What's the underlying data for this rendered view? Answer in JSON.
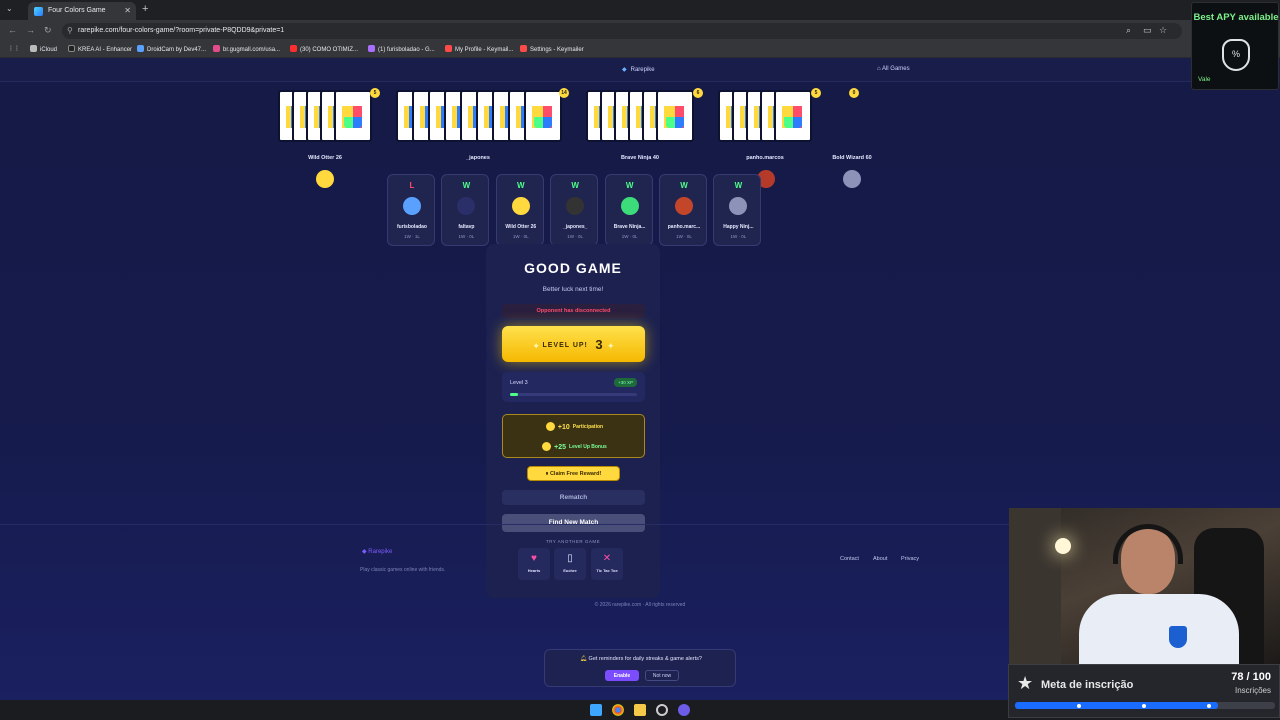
{
  "browser": {
    "tab_title": "Four Colors Game",
    "url": "rarepike.com/four-colors-game/?room=private-P8QDD9&private=1",
    "bookmarks": [
      "iCloud",
      "KREA AI - Enhancer",
      "DroidCam by Dev47...",
      "br.gugmall.com/usa...",
      "(30) COMO OTIMIZ...",
      "(1) furisboladao - G...",
      "My Profile - Keymail...",
      "Settings - Keymailer"
    ]
  },
  "site": {
    "brand": "Rarepike",
    "all_games": "All Games"
  },
  "players": [
    {
      "name": "Wild Otter 26",
      "cards": "5"
    },
    {
      "name": "_japones",
      "cards": "14"
    },
    {
      "name": "Brave Ninja 40",
      "cards": "6"
    },
    {
      "name": "panho.marcos",
      "cards": "5"
    },
    {
      "name": "Bold Wizard 60",
      "cards": "0"
    }
  ],
  "results": [
    {
      "res": "L",
      "name": "furisboladao",
      "wl": "1W · 1L",
      "color": "#ff4d6a"
    },
    {
      "res": "W",
      "name": "faltavp",
      "wl": "1W · 0L",
      "color": "#4cff88"
    },
    {
      "res": "W",
      "name": "Wild Otter 26",
      "wl": "1W · 0L",
      "color": "#4cff88"
    },
    {
      "res": "W",
      "name": "_japones_",
      "wl": "1W · 0L",
      "color": "#4cff88"
    },
    {
      "res": "W",
      "name": "Brave Ninja...",
      "wl": "1W · 0L",
      "color": "#4cff88"
    },
    {
      "res": "W",
      "name": "panho.marc...",
      "wl": "1W · 0L",
      "color": "#4cff88"
    },
    {
      "res": "W",
      "name": "Happy Ninj...",
      "wl": "1W · 0L",
      "color": "#4cff88"
    }
  ],
  "modal": {
    "title": "GOOD GAME",
    "subtitle": "Better luck next time!",
    "disconnected": "Opponent has disconnected",
    "level_up_label": "LEVEL UP!",
    "level_up_num": "3",
    "level_text": "Level 3",
    "xp_badge": "+30 XP",
    "level_progress": 0.06,
    "coin1_amount": "+10",
    "coin1_label": "Participation",
    "coin2_amount": "+25",
    "coin2_label": "Level Up Bonus",
    "claim": "Claim Free Reward!",
    "rematch": "Rematch",
    "find_match": "Find New Match",
    "try_another": "TRY ANOTHER GAME",
    "games": [
      {
        "label": "Hearts",
        "icon": "heart-icon"
      },
      {
        "label": "Euchre",
        "icon": "card-icon"
      },
      {
        "label": "Tic Tac Toe",
        "icon": "x-icon"
      }
    ]
  },
  "footer": {
    "brand": "Rarepike",
    "tagline": "Play classic games online with friends.",
    "contact": "Contact",
    "about": "About",
    "privacy": "Privacy",
    "copyright": "© 2026 rarepike.com · All rights reserved"
  },
  "notice": {
    "text": "Get reminders for daily streaks & game alerts?",
    "enable": "Enable",
    "not_now": "Not now"
  },
  "apy": {
    "title": "Best APY available",
    "tag": "Vale"
  },
  "goal": {
    "title": "Meta de inscrição",
    "count": "78 / 100",
    "sub": "Inscrições",
    "progress": 0.78
  },
  "colors": {
    "red": "#ff4d6a",
    "green": "#4cff88",
    "yellow": "#ffd93d",
    "blue": "#2d7dff"
  }
}
